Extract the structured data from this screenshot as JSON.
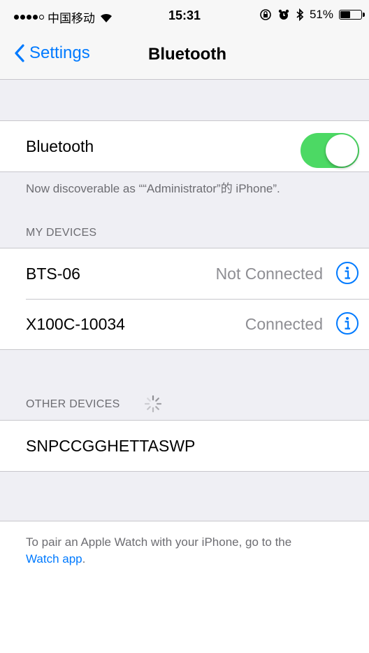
{
  "status_bar": {
    "carrier": "中国移动",
    "time": "15:31",
    "battery": "51%",
    "battery_level": 0.51
  },
  "nav": {
    "back_label": "Settings",
    "title": "Bluetooth"
  },
  "bluetooth": {
    "label": "Bluetooth",
    "enabled": true,
    "discoverable_text": "Now discoverable as ““Administrator”的 iPhone”."
  },
  "my_devices": {
    "header": "MY DEVICES",
    "items": [
      {
        "name": "BTS-06",
        "status": "Not Connected"
      },
      {
        "name": "X100C-10034",
        "status": "Connected"
      }
    ]
  },
  "other_devices": {
    "header": "OTHER DEVICES",
    "items": [
      {
        "name": "SNPCCGGHETTASWP"
      }
    ]
  },
  "watch_note": {
    "text": "To pair an Apple Watch with your iPhone, go to the",
    "link": "Watch app",
    "end": "."
  },
  "colors": {
    "accent": "#007aff",
    "toggle_on": "#4cd964",
    "background": "#efeff4"
  }
}
